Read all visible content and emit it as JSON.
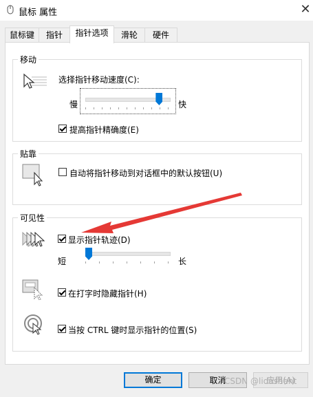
{
  "window": {
    "title": "鼠标 属性",
    "close_glyph": "✕"
  },
  "tabs": [
    {
      "label": "鼠标键"
    },
    {
      "label": "指针"
    },
    {
      "label": "指针选项",
      "active": true
    },
    {
      "label": "滑轮"
    },
    {
      "label": "硬件"
    }
  ],
  "motion": {
    "legend": "移动",
    "speed_label": "选择指针移动速度(C):",
    "slow_label": "慢",
    "fast_label": "快",
    "speed_level": 0.88,
    "enhance_label": "提高指针精确度(E)",
    "enhance_checked": true
  },
  "snap": {
    "legend": "贴靠",
    "snap_label": "自动将指针移动到对话框中的默认按钮(U)",
    "snap_checked": false
  },
  "visibility": {
    "legend": "可见性",
    "trails_label": "显示指针轨迹(D)",
    "trails_checked": true,
    "short_label": "短",
    "long_label": "长",
    "trails_level": 0.0,
    "hide_label": "在打字时隐藏指针(H)",
    "hide_checked": true,
    "ctrl_label": "当按 CTRL 键时显示指针的位置(S)",
    "ctrl_checked": true
  },
  "buttons": {
    "ok": "确定",
    "cancel": "取消",
    "apply": "应用(A)"
  },
  "watermark": "CSDN @lidashent",
  "colors": {
    "accent": "#0078d7",
    "arrow": "#e53935"
  },
  "icons": [
    "mouse-icon",
    "pointer-speed-icon",
    "snap-button-icon",
    "pointer-trails-icon",
    "hide-pointer-icon",
    "ctrl-locate-icon",
    "red-arrow-annotation"
  ]
}
